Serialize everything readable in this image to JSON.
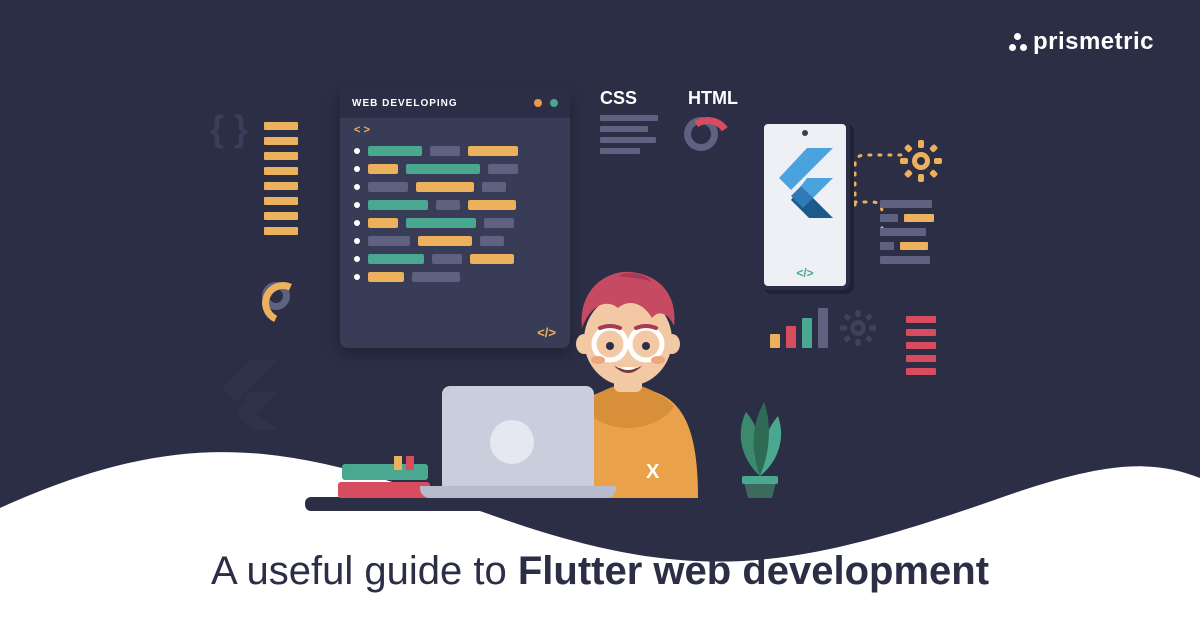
{
  "brand": {
    "name": "prismetric"
  },
  "tagline": {
    "prefix": "A useful guide to ",
    "bold": "Flutter web development"
  },
  "code_window": {
    "title": "WEB DEVELOPING",
    "open_tag": "< >",
    "close_tag": "</>"
  },
  "labels": {
    "css": "CSS",
    "html": "HTML",
    "phone_footer": "</>"
  },
  "person": {
    "shirt_mark": "X"
  },
  "colors": {
    "bg": "#2b2e45",
    "panel": "#383c56",
    "teal": "#49a88f",
    "orange": "#ecb15c",
    "red": "#d84c5f",
    "gray": "#5e6280",
    "skin": "#f3c9a5",
    "hair": "#c74a63",
    "shirt": "#e9a24a",
    "laptop": "#c9cedd"
  }
}
